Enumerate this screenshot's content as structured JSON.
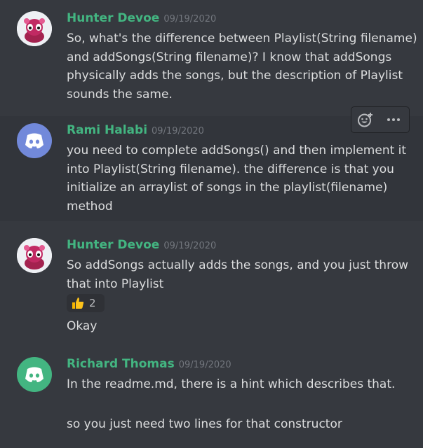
{
  "messages": [
    {
      "author": "Hunter Devoe",
      "timestamp": "09/19/2020",
      "lines": [
        "So, what's the difference between Playlist(String filename) and addSongs(String filename)? I know that addSongs physically adds the songs, but the description of Playlist sounds the same."
      ],
      "avatar": "pink-creature-avatar"
    },
    {
      "author": "Rami Halabi",
      "timestamp": "09/19/2020",
      "lines": [
        "you need to complete addSongs() and then implement it into Playlist(String filename). the difference is that you initialize an arraylist of songs in the playlist(filename) method"
      ],
      "avatar": "discord-default-avatar-blue"
    },
    {
      "author": "Hunter Devoe",
      "timestamp": "09/19/2020",
      "lines": [
        "So addSongs actually adds the songs, and you just throw that into Playlist",
        "Okay"
      ],
      "reaction": {
        "emoji": "thumbs-up",
        "count": "2"
      },
      "avatar": "pink-creature-avatar"
    },
    {
      "author": "Richard Thomas",
      "timestamp": "09/19/2020",
      "lines": [
        "In the readme.md, there is a hint which describes that.",
        "so you just need two lines for that constructor"
      ],
      "avatar": "discord-default-avatar-green"
    }
  ],
  "toolbar": {
    "icons": [
      "add-reaction-icon",
      "more-options-icon"
    ]
  },
  "colors": {
    "background": "#36393f",
    "username": "#43b581",
    "timestamp": "#72767d",
    "text": "#dcddde",
    "blurple": "#7289da",
    "green": "#43b581"
  }
}
